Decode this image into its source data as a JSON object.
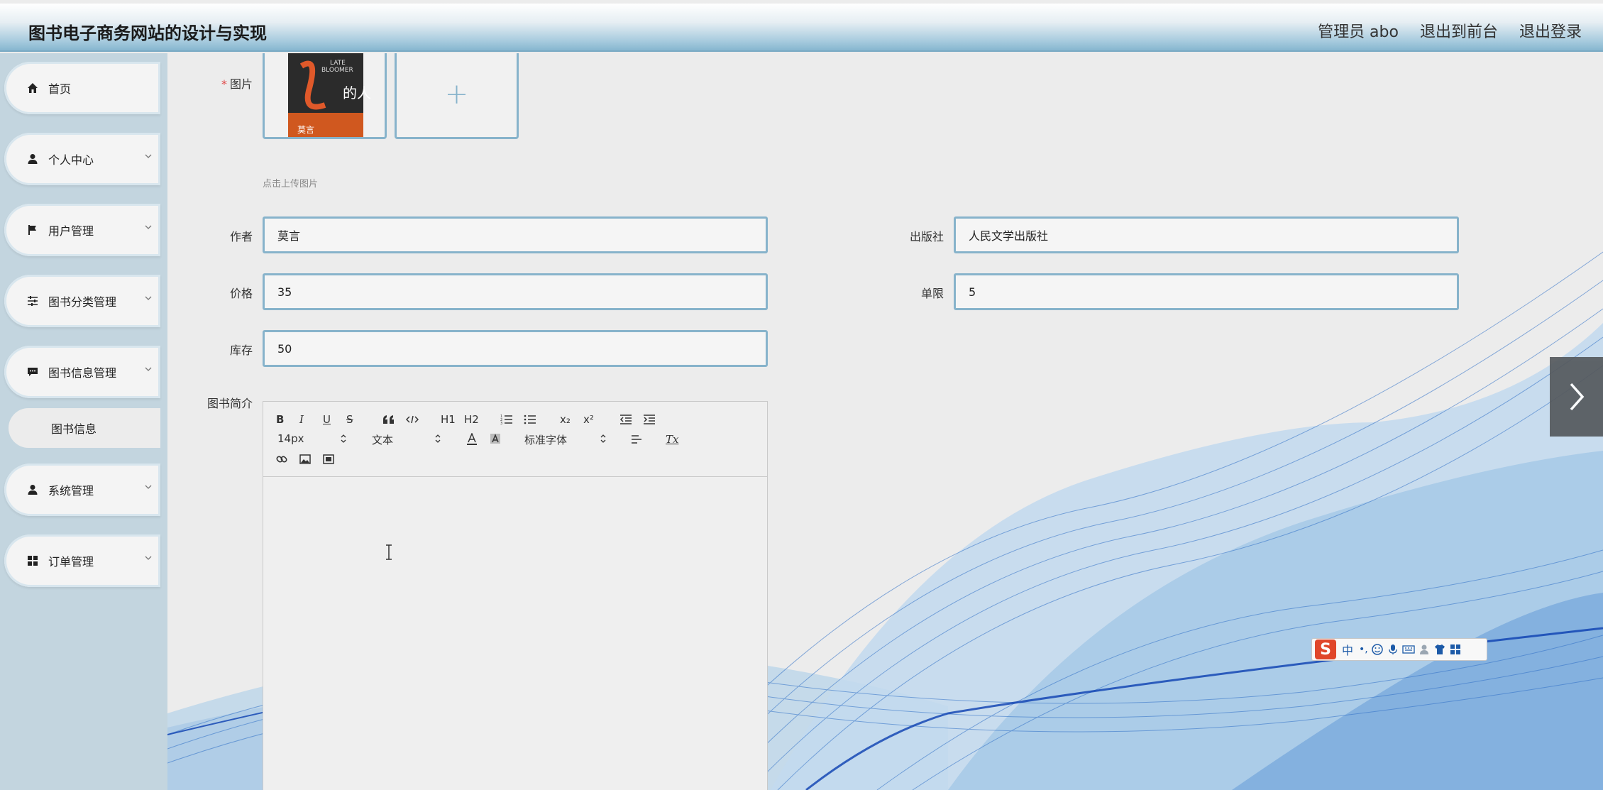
{
  "header": {
    "app_title": "图书电子商务网站的设计与实现",
    "admin_label": "管理员 abo",
    "back_to_front": "退出到前台",
    "logout": "退出登录"
  },
  "sidebar": {
    "items": [
      {
        "label": "首页",
        "icon": "home-icon"
      },
      {
        "label": "个人中心",
        "icon": "user-icon"
      },
      {
        "label": "用户管理",
        "icon": "flag-icon"
      },
      {
        "label": "图书分类管理",
        "icon": "sliders-icon"
      },
      {
        "label": "图书信息管理",
        "icon": "chat-icon"
      },
      {
        "label": "图书信息",
        "icon": ""
      },
      {
        "label": "系统管理",
        "icon": "user-icon"
      },
      {
        "label": "订单管理",
        "icon": "grid-icon"
      }
    ]
  },
  "form": {
    "image_label": "图片",
    "required_mark": "*",
    "upload_hint": "点击上传图片",
    "upload_plus": "+",
    "author_label": "作者",
    "author_value": "莫言",
    "publisher_label": "出版社",
    "publisher_value": "人民文学出版社",
    "price_label": "价格",
    "price_value": "35",
    "limit_label": "单限",
    "limit_value": "5",
    "stock_label": "库存",
    "stock_value": "50",
    "intro_label": "图书简介"
  },
  "book_cover": {
    "line1": "LATE",
    "line2": "BLOOMER",
    "title_cn": "的人",
    "author_cn": "莫言"
  },
  "editor": {
    "bold": "B",
    "italic": "I",
    "underline": "U",
    "strike": "S",
    "h1": "H1",
    "h2": "H2",
    "sub": "x₂",
    "sup": "x²",
    "font_size": "14px",
    "paragraph": "文本",
    "font_family": "标准字体",
    "clear_format": "Tx"
  },
  "ime": {
    "logo": "S",
    "mode": "中",
    "punct": "•,"
  },
  "colors": {
    "accent": "#87b3cb",
    "sidebar_bg": "#c3d5df",
    "required": "#e04b4b"
  }
}
